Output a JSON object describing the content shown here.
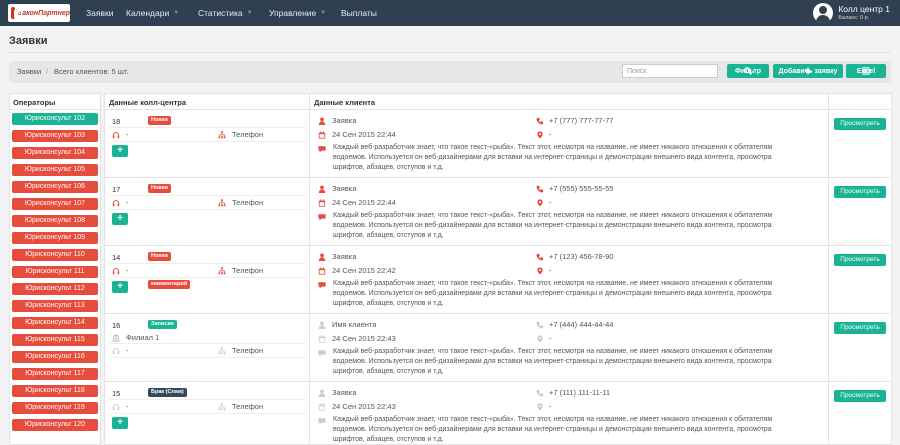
{
  "logo": {
    "text": "ЗаконПартнер"
  },
  "nav": [
    {
      "label": "Заявки",
      "caret": false
    },
    {
      "label": "Календари",
      "caret": true
    },
    {
      "label": "Статистика",
      "caret": true
    },
    {
      "label": "Управление",
      "caret": true
    },
    {
      "label": "Выплаты",
      "caret": false
    }
  ],
  "user": {
    "name": "Колл центр 1",
    "balance": "Баланс: 0 р."
  },
  "page": {
    "title": "Заявки"
  },
  "breadcrumb": {
    "root": "Заявки",
    "separator": "/",
    "total": "Всего клиентов: 5 шт."
  },
  "toolbar": {
    "search_placeholder": "Поиск",
    "filter_label": "Фильтр",
    "add_label": "Добавить заявку",
    "excel_label": "Excel"
  },
  "operators": {
    "header": "Операторы",
    "items": [
      {
        "label": "Юрисконсульт 102",
        "active": true
      },
      {
        "label": "Юрисконсульт 103",
        "active": false
      },
      {
        "label": "Юрисконсульт 104",
        "active": false
      },
      {
        "label": "Юрисконсульт 105",
        "active": false
      },
      {
        "label": "Юрисконсульт 106",
        "active": false
      },
      {
        "label": "Юрисконсульт 107",
        "active": false
      },
      {
        "label": "Юрисконсульт 108",
        "active": false
      },
      {
        "label": "Юрисконсульт 109",
        "active": false
      },
      {
        "label": "Юрисконсульт 110",
        "active": false
      },
      {
        "label": "Юрисконсульт 111",
        "active": false
      },
      {
        "label": "Юрисконсульт 112",
        "active": false
      },
      {
        "label": "Юрисконсульт 113",
        "active": false
      },
      {
        "label": "Юрисконсульт 114",
        "active": false
      },
      {
        "label": "Юрисконсульт 115",
        "active": false
      },
      {
        "label": "Юрисконсульт 116",
        "active": false
      },
      {
        "label": "Юрисконсульт 117",
        "active": false
      },
      {
        "label": "Юрисконсульт 118",
        "active": false
      },
      {
        "label": "Юрисконсульт 119",
        "active": false
      },
      {
        "label": "Юрисконсульт 120",
        "active": false
      }
    ]
  },
  "table": {
    "col_callcenter": "Данные колл-центра",
    "col_client": "Данные клиента",
    "view_label": "Просмотреть"
  },
  "colors": {
    "accent": "#1ab394",
    "danger": "#e74c3c",
    "navbar": "#2f4050",
    "dark_badge": "#34495e",
    "muted": "#cccccc"
  },
  "rows": [
    {
      "id": "18",
      "status": "Новая",
      "status_color": "#e74c3c",
      "source": "-",
      "channel": "Телефон",
      "branch": "",
      "comment": "",
      "name": "Заявка",
      "phone": "+7 (777) 777-77-77",
      "date": "24 Сен 2015 22:44",
      "address": "-",
      "muted": false,
      "desc": "Каждый веб-разработчик знает, что такое текст-«рыба». Текст этот, несмотря на название, не имеет никакого отношения к обитателям водоемов. Используется он веб-дизайнерами для вставки на интернет-страницы и демонстрации внешнего вида контента, просмотра шрифтов, абзацев, отступов и т.д."
    },
    {
      "id": "17",
      "status": "Новая",
      "status_color": "#e74c3c",
      "source": "-",
      "channel": "Телефон",
      "branch": "",
      "comment": "",
      "name": "Заявка",
      "phone": "+7 (555) 555-55-55",
      "date": "24 Сен 2015 22:44",
      "address": "-",
      "muted": false,
      "desc": "Каждый веб-разработчик знает, что такое текст-«рыба». Текст этот, несмотря на название, не имеет никакого отношения к обитателям водоемов. Используется он веб-дизайнерами для вставки на интернет-страницы и демонстрации внешнего вида контента, просмотра шрифтов, абзацев, отступов и т.д."
    },
    {
      "id": "14",
      "status": "Новая",
      "status_color": "#e74c3c",
      "source": "-",
      "channel": "Телефон",
      "branch": "",
      "comment": "камментарий",
      "name": "Заявка",
      "phone": "+7 (123) 456-78-90",
      "date": "24 Сен 2015 22:42",
      "address": "-",
      "muted": false,
      "desc": "Каждый веб-разработчик знает, что такое текст-«рыба». Текст этот, несмотря на название, не имеет никакого отношения к обитателям водоемов. Используется он веб-дизайнерами для вставки на интернет-страницы и демонстрации внешнего вида контента, просмотра шрифтов, абзацев, отступов и т.д."
    },
    {
      "id": "16",
      "status": "Записан",
      "status_color": "#1ab394",
      "source": "-",
      "channel": "Телефон",
      "branch": "Филиал 1",
      "comment": "",
      "name": "Имя клиента",
      "phone": "+7 (444) 444-44-44",
      "date": "24 Сен 2015 22:43",
      "address": "-",
      "muted": true,
      "desc": "Каждый веб-разработчик знает, что такое текст-«рыба». Текст этот, несмотря на название, не имеет никакого отношения к обитателям водоемов. Используется он веб-дизайнерами для вставки на интернет-страницы и демонстрации внешнего вида контента, просмотра шрифтов, абзацев, отступов и т.д."
    },
    {
      "id": "15",
      "status": "Брак (Спам)",
      "status_color": "#34495e",
      "source": "-",
      "channel": "Телефон",
      "branch": "",
      "comment": "",
      "name": "Заявка",
      "phone": "+7 (111) 111-11-11",
      "date": "24 Сен 2015 22:43",
      "address": "-",
      "muted": true,
      "desc": "Каждый веб-разработчик знает, что такое текст-«рыба». Текст этот, несмотря на название, не имеет никакого отношения к обитателям водоемов. Используется он веб-дизайнерами для вставки на интернет-страницы и демонстрации внешнего вида контента, просмотра шрифтов, абзацев, отступов и т.д."
    }
  ]
}
